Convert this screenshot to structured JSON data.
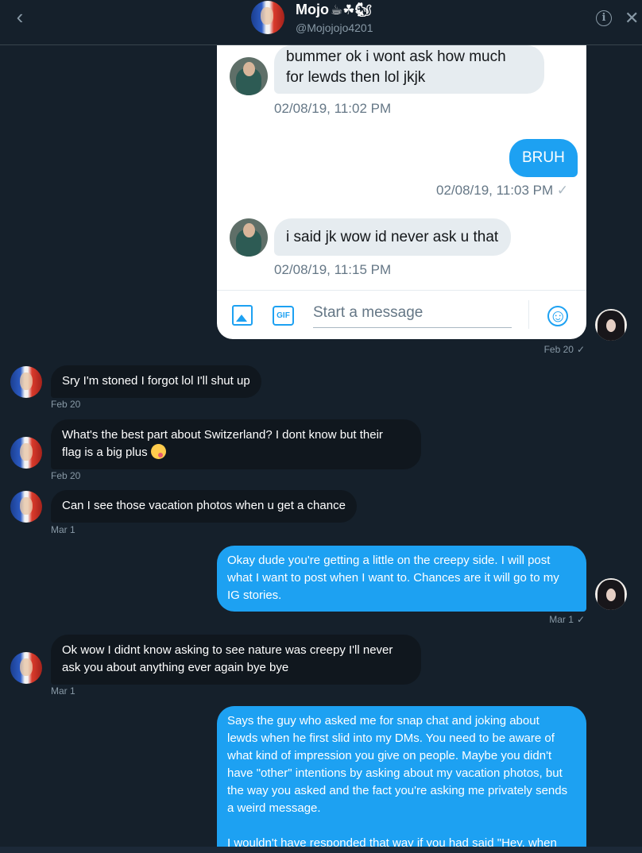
{
  "header": {
    "name": "Mojo",
    "name_emoji": "☕☘🐿",
    "handle": "@Mojojojo4201",
    "back_icon": "chevron-left-icon",
    "info_icon": "info-icon",
    "close_icon": "close-icon"
  },
  "screenshot": {
    "messages": [
      {
        "side": "in",
        "text_line1": "bummer ok i wont ask how much",
        "text_line2": "for lewds then lol jkjk",
        "time": "02/08/19, 11:02 PM"
      },
      {
        "side": "out",
        "text": "BRUH",
        "time": "02/08/19, 11:03 PM"
      },
      {
        "side": "in",
        "text": "i said jk wow  id never ask u that",
        "time": "02/08/19, 11:15 PM"
      }
    ],
    "composer": {
      "placeholder": "Start a message",
      "gif_label": "GIF",
      "emoji_glyph": "☺"
    },
    "check": "✓"
  },
  "thread": [
    {
      "side": "out-image",
      "time": "Feb 20"
    },
    {
      "side": "in",
      "text": "Sry I'm stoned I forgot lol I'll shut up",
      "time": "Feb 20"
    },
    {
      "side": "in",
      "text_line1": "What's the best part about  Switzerland? I dont know but their",
      "text_line2": "flag is a big plus",
      "time": "Feb 20"
    },
    {
      "side": "in",
      "text": "Can I see those vacation photos when u get a chance",
      "time": "Mar 1"
    },
    {
      "side": "out",
      "text_line1": "Okay dude you're getting a little on the creepy side. I will post",
      "text_line2": "what I want to post when I want to. Chances are it will go to my",
      "text_line3": "IG stories.",
      "time": "Mar 1"
    },
    {
      "side": "in",
      "text_line1": "Ok wow I didnt know asking to see nature was creepy I'll never",
      "text_line2": "ask you about anything ever again bye bye",
      "time": "Mar 1"
    },
    {
      "side": "out",
      "text_line1": "Says the guy who asked me for snap chat and joking about",
      "text_line2": "lewds when he first slid into my DMs. You need to be aware of",
      "text_line3": "what kind of impression you give on people. Maybe you didn't",
      "text_line4": "have \"other\" intentions by asking about my vacation photos, but",
      "text_line5": "the way you asked and the fact you're asking me privately sends",
      "text_line6": "a weird message.",
      "text_line7": "I wouldn't have responded that way if you had said \"Hey, when"
    }
  ],
  "colors": {
    "background": "#15202b",
    "accent": "#1da1f2",
    "incoming": "#10171e",
    "muted": "#8899a6"
  }
}
